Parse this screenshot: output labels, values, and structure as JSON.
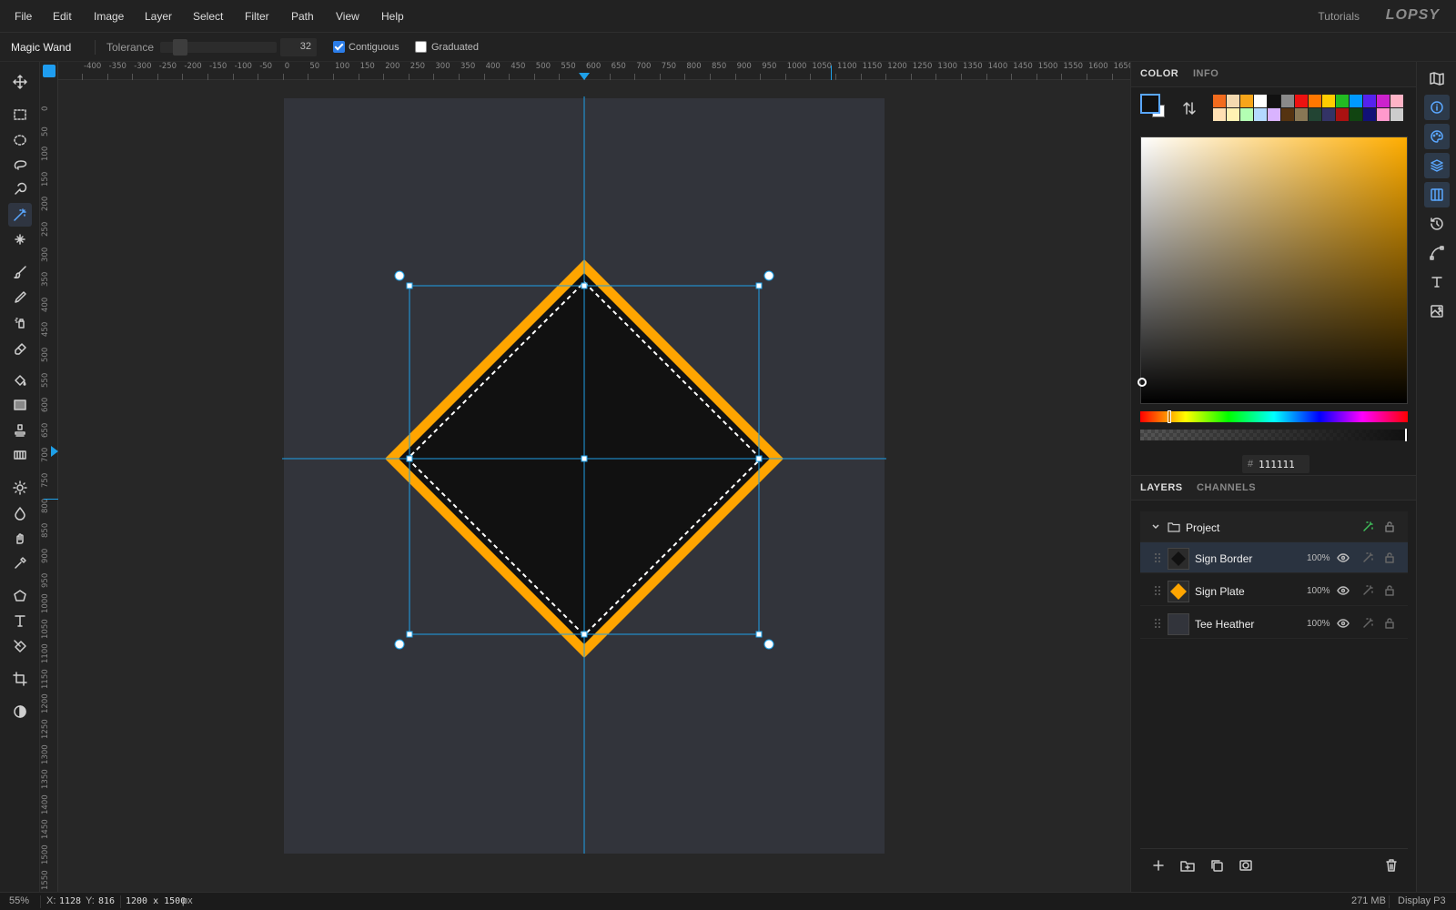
{
  "menubar": {
    "items": [
      "File",
      "Edit",
      "Image",
      "Layer",
      "Select",
      "Filter",
      "Path",
      "View",
      "Help"
    ],
    "tutorials": "Tutorials",
    "logo": "LOPSY"
  },
  "options": {
    "tool_name": "Magic Wand",
    "tolerance_label": "Tolerance",
    "tolerance_value": "32",
    "contiguous_label": "Contiguous",
    "contiguous_checked": true,
    "graduated_label": "Graduated",
    "graduated_checked": false
  },
  "rulers": {
    "h_ticks": [
      "-400",
      "-350",
      "-300",
      "-250",
      "-200",
      "-150",
      "-100",
      "-50",
      "0",
      "50",
      "100",
      "150",
      "200",
      "250",
      "300",
      "350",
      "400",
      "450",
      "500",
      "550",
      "600",
      "650",
      "700",
      "750",
      "800",
      "850",
      "900",
      "950",
      "1000",
      "1050",
      "1100",
      "1150",
      "1200",
      "1250",
      "1300",
      "1350",
      "1400",
      "1450",
      "1500",
      "1550",
      "1600",
      "1650"
    ],
    "v_ticks": [
      "0",
      "50",
      "100",
      "150",
      "200",
      "250",
      "300",
      "350",
      "400",
      "450",
      "500",
      "550",
      "600",
      "650",
      "700",
      "750",
      "800",
      "850",
      "900",
      "950",
      "1000",
      "1050",
      "1100",
      "1150",
      "1200",
      "1250",
      "1300",
      "1350",
      "1400",
      "1450",
      "1500",
      "1550"
    ]
  },
  "tools": [
    "move-tool",
    "rect-select-tool",
    "ellipse-select-tool",
    "lasso-tool",
    "quick-select-tool",
    "magic-wand-tool",
    "healing-tool",
    "brush-tool",
    "pencil-tool",
    "spray-tool",
    "eraser-tool",
    "bucket-tool",
    "gradient-tool",
    "stamp-tool",
    "pattern-tool",
    "dodge-tool",
    "burn-tool",
    "smudge-tool",
    "eyedropper-tool",
    "shape-tool",
    "text-tool",
    "pen-tool",
    "crop-tool",
    "mask-tool"
  ],
  "active_tool": "magic-wand-tool",
  "canvas": {
    "document_bg": "#32343b",
    "plate_color": "#ffa500",
    "fill_color": "#111111",
    "guide_color": "#1ea0e8"
  },
  "color_panel": {
    "tabs": [
      "COLOR",
      "INFO"
    ],
    "active_tab": "COLOR",
    "foreground": "#111111",
    "background": "#ffffff",
    "swatches": [
      "#f26b1d",
      "#f3d9b0",
      "#f7a51a",
      "#ffffff",
      "#111111",
      "#8a8a8a",
      "#ee1111",
      "#ff7700",
      "#ffcc00",
      "#22bb22",
      "#0099ff",
      "#5522ee",
      "#cc22cc",
      "#ffb3c6",
      "#ffe0b3",
      "#fff2b3",
      "#b3ffb3",
      "#b3d9ff",
      "#d9b3ff",
      "#553311",
      "#887755",
      "#224433",
      "#333366",
      "#aa1111",
      "#114411",
      "#111177",
      "#ff99cc",
      "#cccccc"
    ],
    "hex_label": "#",
    "hex_value": "111111"
  },
  "layers_panel": {
    "tabs": [
      "LAYERS",
      "CHANNELS"
    ],
    "active_tab": "LAYERS",
    "group": "Project",
    "layers": [
      {
        "name": "Sign Border",
        "opacity": "100%",
        "selected": true
      },
      {
        "name": "Sign Plate",
        "opacity": "100%",
        "selected": false
      },
      {
        "name": "Tee Heather",
        "opacity": "100%",
        "selected": false
      }
    ]
  },
  "right_icons": [
    "map-icon",
    "info-icon",
    "palette-icon",
    "layers-icon",
    "channels-icon",
    "history-icon",
    "path-icon",
    "type-icon",
    "image-icon"
  ],
  "status": {
    "zoom": "55%",
    "coords_x_label": "X:",
    "coords_x": "1128",
    "coords_y_label": "Y:",
    "coords_y": "816",
    "doc_size": "1200 x 1500",
    "doc_unit": "px",
    "memory": "271 MB",
    "color_profile": "Display P3"
  }
}
